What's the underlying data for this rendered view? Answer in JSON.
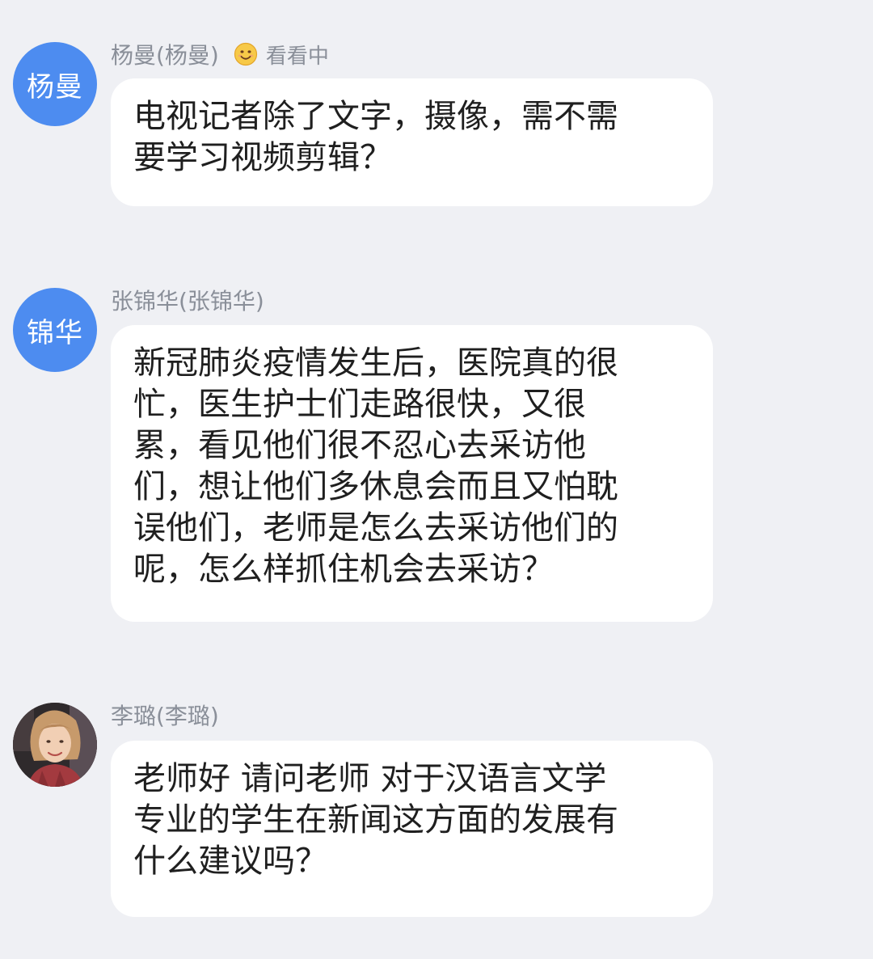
{
  "messages": [
    {
      "avatar_text": "杨曼",
      "avatar_color": "#4d8cf0",
      "sender": "杨曼(杨曼)",
      "status_icon": "smiling-face-emoji",
      "status_text": "看看中",
      "text": "电视记者除了文字，摄像，需不需\n要学习视频剪辑？"
    },
    {
      "avatar_text": "锦华",
      "avatar_color": "#4d8cf0",
      "sender": "张锦华(张锦华)",
      "text": "新冠肺炎疫情发生后，医院真的很\n忙，医生护士们走路很快，又很\n累，看见他们很不忍心去采访他\n们，想让他们多休息会而且又怕耽\n误他们，老师是怎么去采访他们的\n呢，怎么样抓住机会去采访？"
    },
    {
      "avatar_icon": "user-photo",
      "sender": "李璐(李璐)",
      "text": "老师好 请问老师 对于汉语言文学\n专业的学生在新闻这方面的发展有\n什么建议吗？"
    }
  ]
}
